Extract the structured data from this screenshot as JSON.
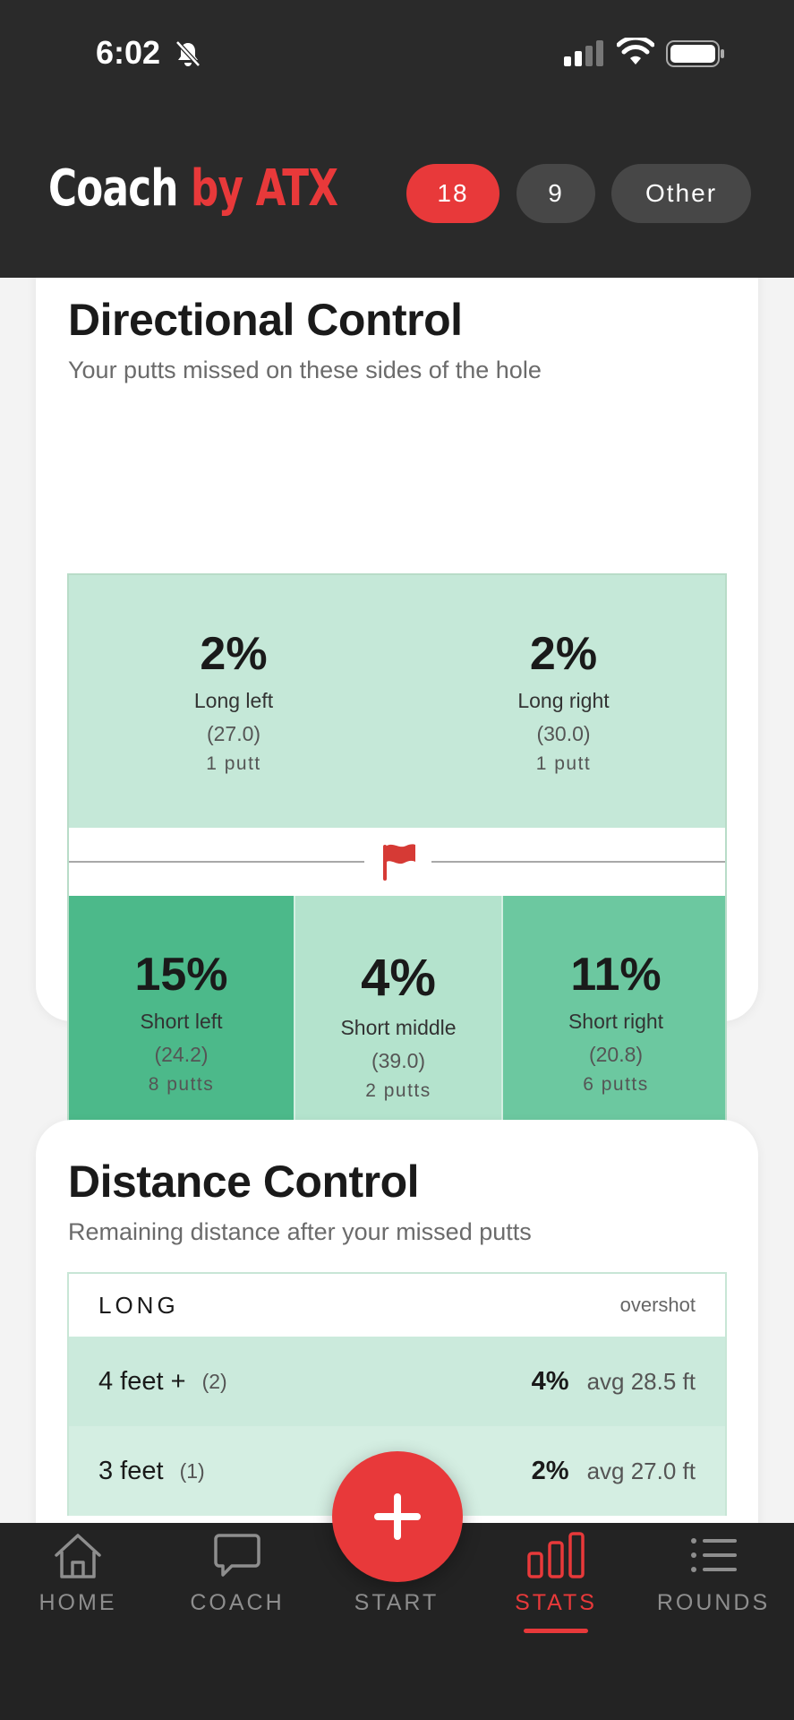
{
  "status": {
    "time": "6:02"
  },
  "brand": {
    "part1": "Coach",
    "part2": "by ATX"
  },
  "filters": [
    {
      "label": "18",
      "active": true
    },
    {
      "label": "9",
      "active": false
    },
    {
      "label": "Other",
      "active": false
    }
  ],
  "directional": {
    "title": "Directional Control",
    "subtitle": "Your putts missed on these sides of the hole",
    "long_left": {
      "pct": "2%",
      "label": "Long left",
      "avg": "(27.0)",
      "count": "1 putt"
    },
    "long_right": {
      "pct": "2%",
      "label": "Long right",
      "avg": "(30.0)",
      "count": "1 putt"
    },
    "short_left": {
      "pct": "15%",
      "label": "Short left",
      "avg": "(24.2)",
      "count": "8 putts"
    },
    "short_middle": {
      "pct": "4%",
      "label": "Short middle",
      "avg": "(39.0)",
      "count": "2 putts"
    },
    "short_right": {
      "pct": "11%",
      "label": "Short right",
      "avg": "(20.8)",
      "count": "6 putts"
    }
  },
  "distance": {
    "title": "Distance Control",
    "subtitle": "Remaining distance after your missed putts",
    "header_left": "LONG",
    "header_right": "overshot",
    "rows": [
      {
        "name": "4 feet +",
        "count": "(2)",
        "pct": "4%",
        "avg": "avg 28.5 ft"
      },
      {
        "name": "3 feet",
        "count": "(1)",
        "pct": "2%",
        "avg": "avg 27.0 ft"
      }
    ]
  },
  "nav": {
    "home": "HOME",
    "coach": "COACH",
    "start": "START",
    "stats": "STATS",
    "rounds": "ROUNDS"
  },
  "colors": {
    "accent": "#e8393a",
    "header_bg": "#2a2a2a",
    "mint_light": "#c5e8d8",
    "mint_mid": "#b4e3cd",
    "green_mid": "#6cc8a0",
    "green_dark": "#4cb98a"
  }
}
